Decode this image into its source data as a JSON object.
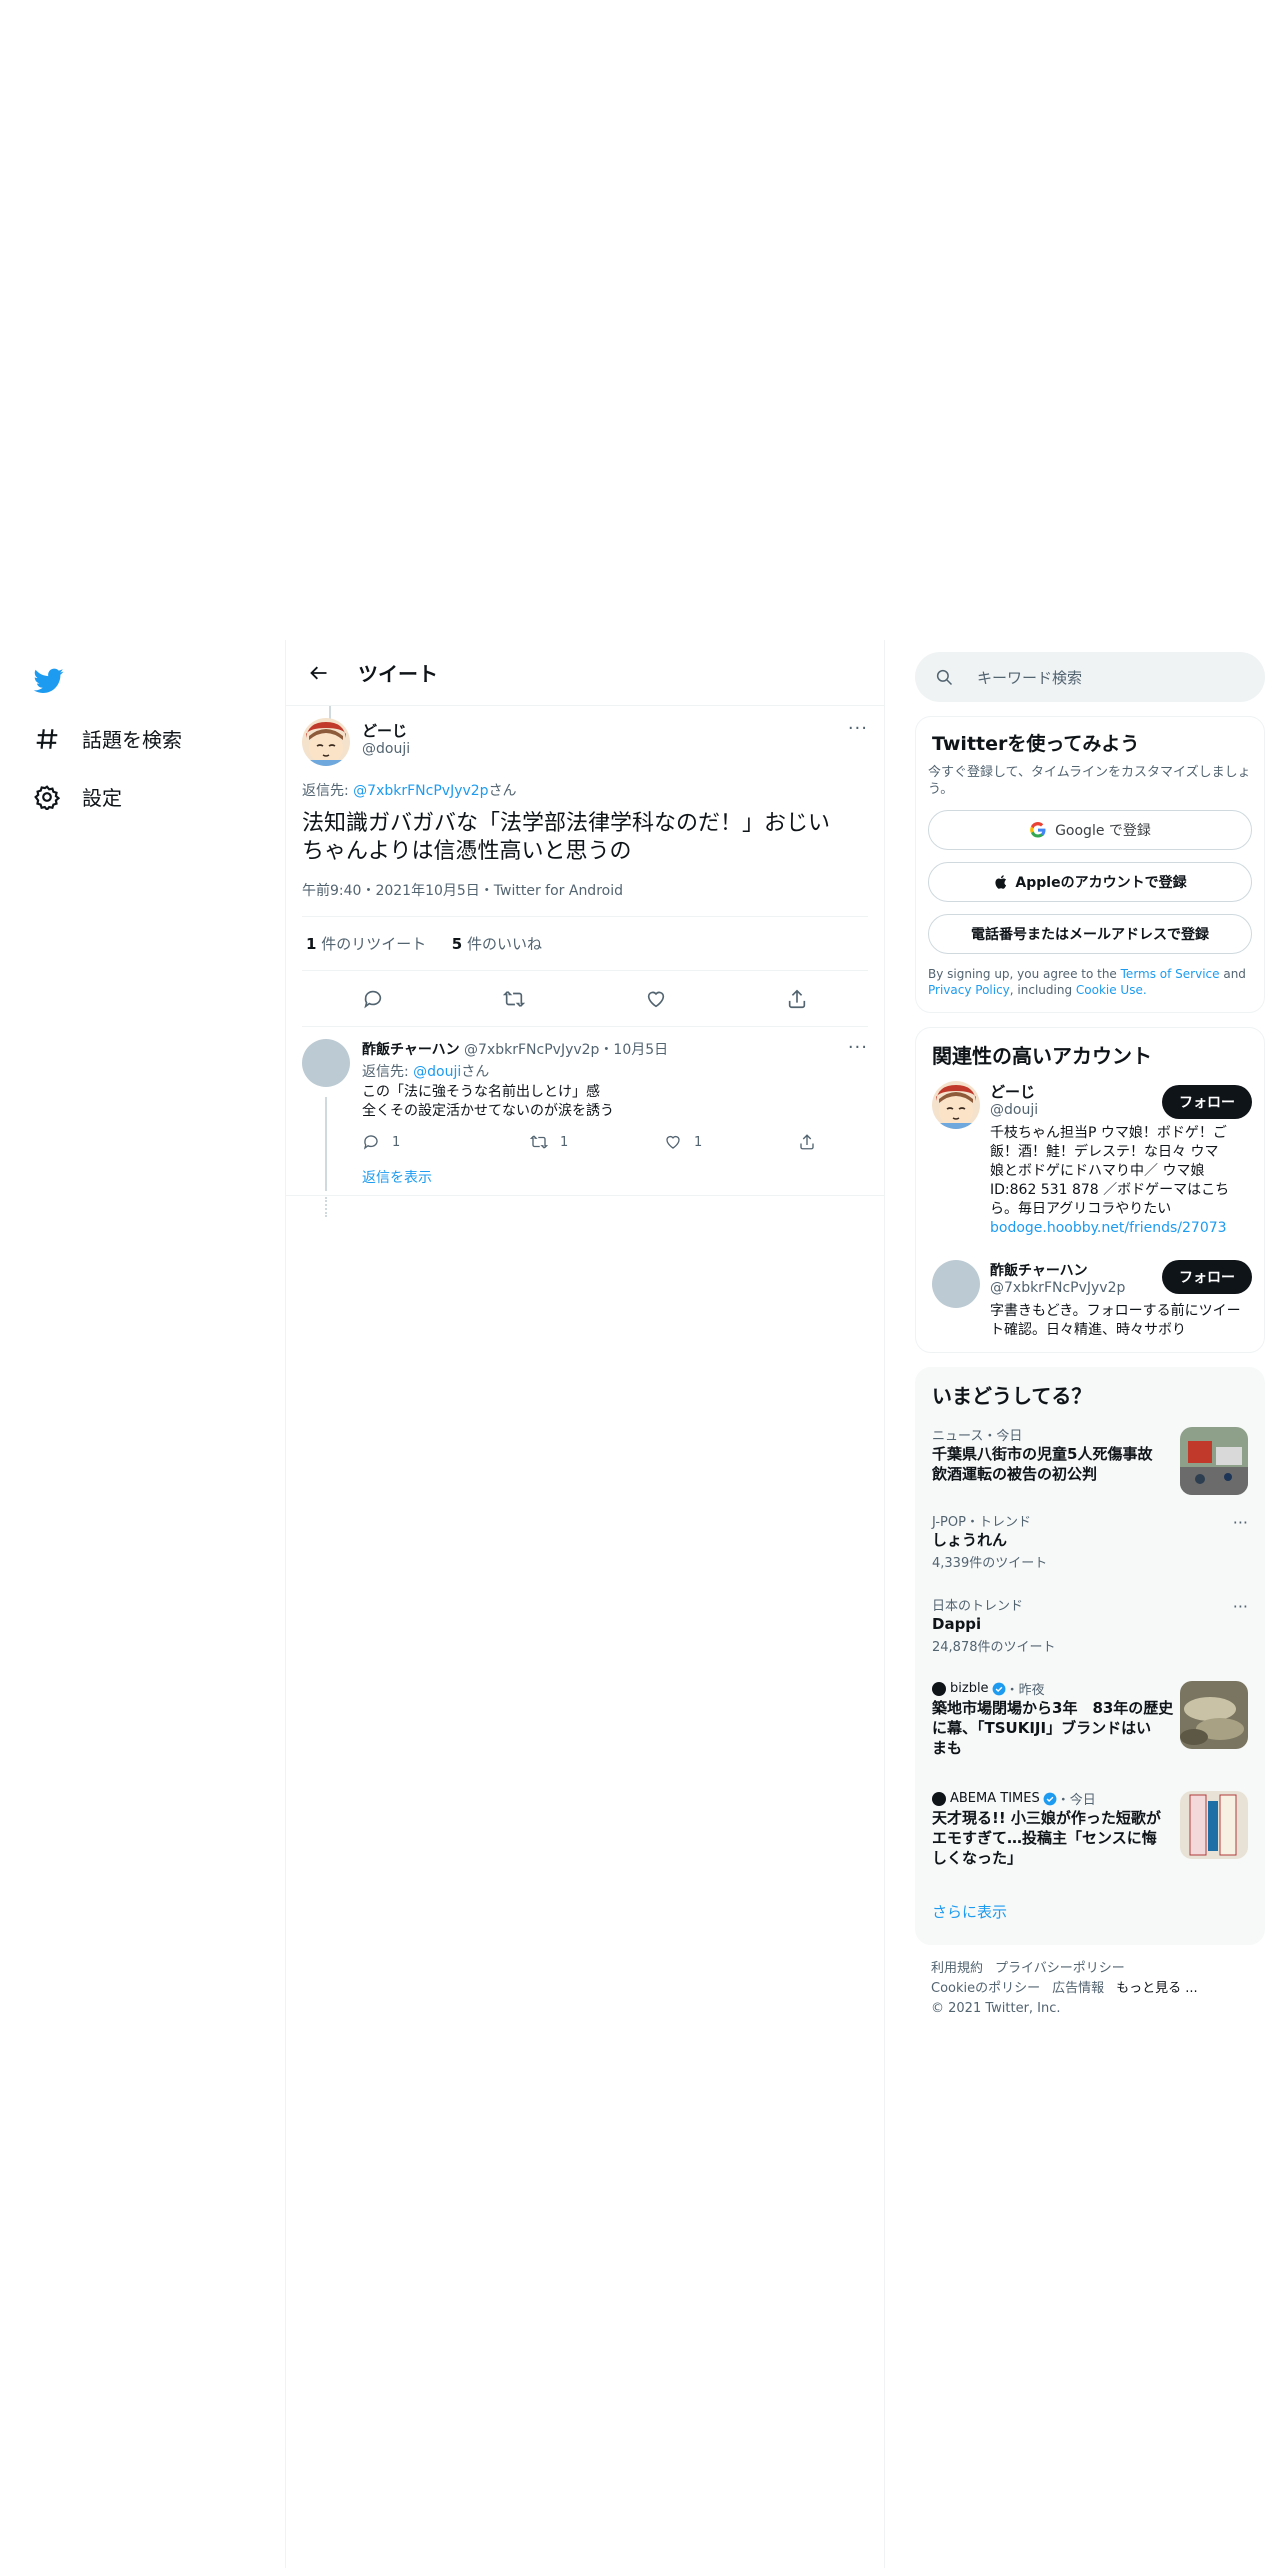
{
  "nav": {
    "explore_label": "話題を検索",
    "settings_label": "設定"
  },
  "header": {
    "title": "ツイート"
  },
  "main_tweet": {
    "display_name": "どーじ",
    "handle": "@douji",
    "reply_prefix": "返信先: ",
    "reply_to": "@7xbkrFNcPvJyv2p",
    "reply_suffix": "さん",
    "text_line1": "法知識ガバガバな「法学部法律学科なのだ！」おじい",
    "text_line2": "ちゃんよりは信憑性高いと思うの",
    "timestamp": "午前9:40・2021年10月5日・Twitter for Android",
    "retweet_count": "1",
    "retweet_label": "件のリツイート",
    "like_count": "5",
    "like_label": "件のいいね"
  },
  "reply_tweet": {
    "display_name": "酢飯チャーハン",
    "handle_date": "@7xbkrFNcPvJyv2p・10月5日",
    "reply_prefix": "返信先: ",
    "reply_to": "@douji",
    "reply_suffix": "さん",
    "text_line1": "この「法に強そうな名前出しとけ」感",
    "text_line2": "全くその設定活かせてないのが涙を誘う",
    "reply_count": "1",
    "retweet_count": "1",
    "like_count": "1",
    "show_replies": "返信を表示"
  },
  "search": {
    "placeholder": "キーワード検索"
  },
  "signup": {
    "title": "Twitterを使ってみよう",
    "subtitle": "今すぐ登録して、タイムラインをカスタマイズしましょう。",
    "google_label": "Google で登録",
    "apple_label": "Appleのアカウントで登録",
    "phone_label": "電話番号またはメールアドレスで登録",
    "legal_1": "By signing up, you agree to the ",
    "tos": "Terms of Service",
    "legal_and": " and",
    "privacy": "Privacy Policy",
    "legal_including": ", including ",
    "cookie": "Cookie Use."
  },
  "relevant": {
    "title": "関連性の高いアカウント",
    "follow_label": "フォロー",
    "accounts": [
      {
        "name": "どーじ",
        "handle": "@douji",
        "bio_1": "千枝ちゃん担当P ウマ娘！ボドゲ！ご",
        "bio_2": "飯！酒！鮭！デレステ！な日々 ウマ",
        "bio_3": "娘とボドゲにドハマり中／ ウマ娘",
        "bio_4": "ID:862 531 878 ／ボドゲーマはこち",
        "bio_5": "ら。毎日アグリコラやりたい",
        "link": "bodoge.hoobby.net/friends/27073"
      },
      {
        "name": "酢飯チャーハン",
        "handle": "@7xbkrFNcPvJyv2p",
        "bio_1": "字書きもどき。フォローする前にツイー",
        "bio_2": "ト確認。日々精進、時々サボり"
      }
    ]
  },
  "trends": {
    "title": "いまどうしてる？",
    "items": [
      {
        "meta": "ニュース・今日",
        "title_1": "千葉県八街市の児童5人死傷事故",
        "title_2": "飲酒運転の被告の初公判"
      },
      {
        "meta": "J-POP・トレンド",
        "title_1": "しょうれん",
        "count": "4,339件のツイート"
      },
      {
        "meta": "日本のトレンド",
        "title_1": "Dappi",
        "count": "24,878件のツイート"
      },
      {
        "source": "bizble",
        "when": "・昨夜",
        "title_1": "築地市場閉場から3年　83年の歴史",
        "title_2": "に幕、「TSUKIJI」ブランドはい",
        "title_3": "まも"
      },
      {
        "source": "ABEMA TIMES",
        "when": "・今日",
        "title_1": "天才現る!! 小三娘が作った短歌が",
        "title_2": "エモすぎて…投稿主「センスに悔",
        "title_3": "しくなった」"
      }
    ],
    "show_more": "さらに表示"
  },
  "footer": {
    "terms": "利用規約",
    "privacy": "プライバシーポリシー",
    "cookie": "Cookieのポリシー",
    "ads": "広告情報",
    "more": "もっと見る ...",
    "copyright": "© 2021 Twitter, Inc."
  }
}
